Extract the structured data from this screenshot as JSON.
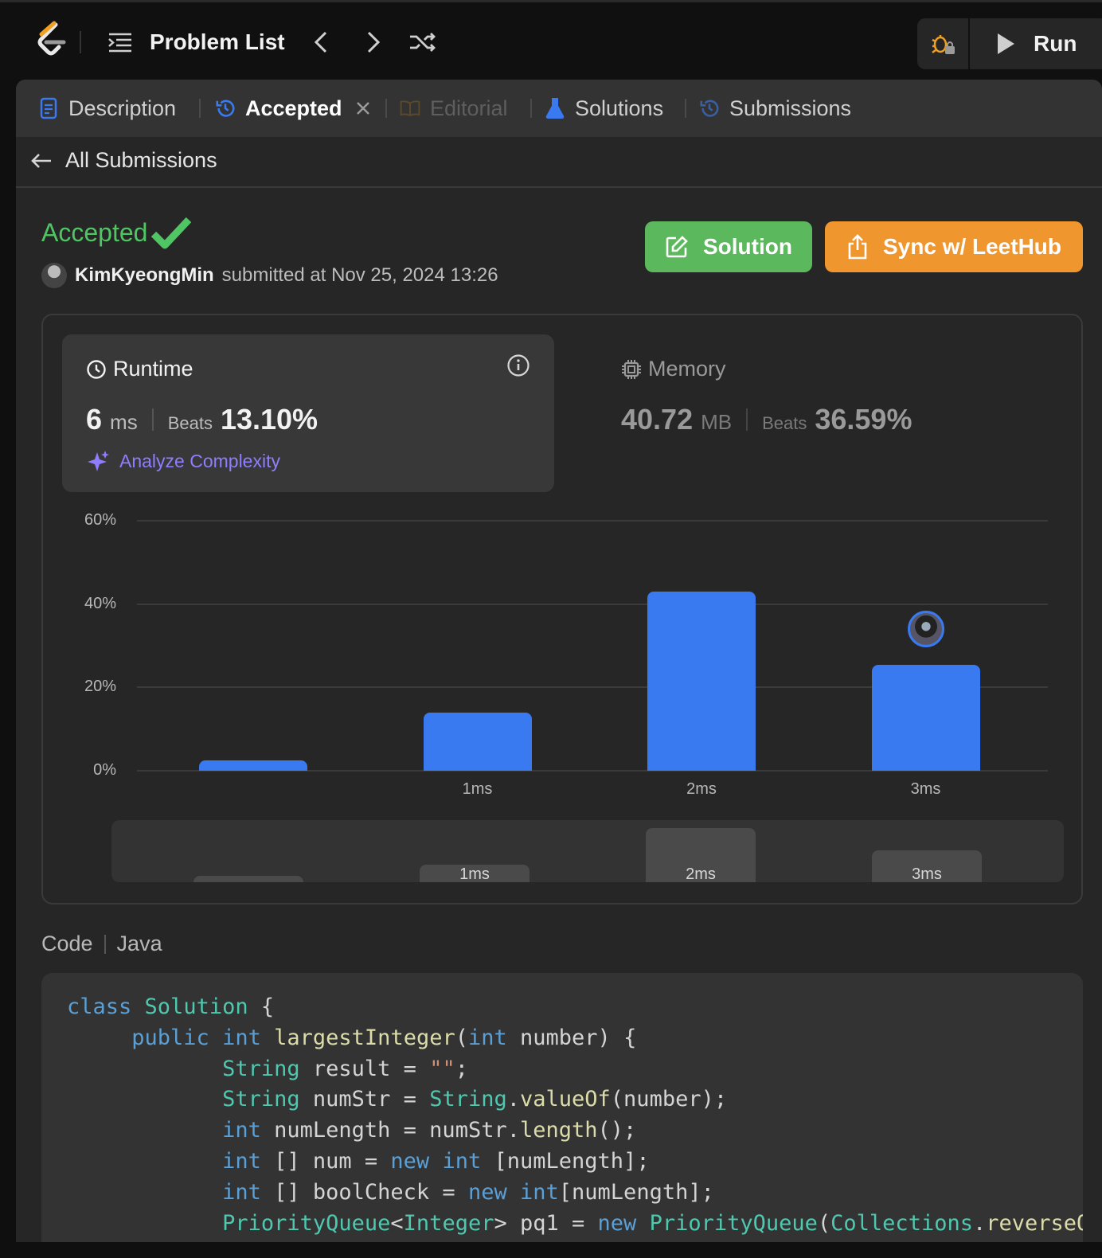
{
  "topbar": {
    "problem_list": "Problem List",
    "run_label": "Run",
    "icons": [
      "leetcode-logo",
      "list-icon",
      "chevron-left-icon",
      "chevron-right-icon",
      "shuffle-icon",
      "debug-icon",
      "play-icon"
    ]
  },
  "tabs": [
    {
      "label": "Description",
      "icon": "description-icon"
    },
    {
      "label": "Accepted",
      "icon": "history-icon",
      "active": true
    },
    {
      "label": "Editorial",
      "icon": "book-icon",
      "disabled": true
    },
    {
      "label": "Solutions",
      "icon": "flask-icon"
    },
    {
      "label": "Submissions",
      "icon": "history-icon"
    }
  ],
  "back_label": "All Submissions",
  "result": {
    "status": "Accepted",
    "user": "KimKyeongMin",
    "submitted": "submitted at Nov 25, 2024 13:26"
  },
  "buttons": {
    "solution": "Solution",
    "sync": "Sync w/ LeetHub"
  },
  "runtime": {
    "title": "Runtime",
    "value": "6",
    "unit": "ms",
    "beats_label": "Beats",
    "beats": "13.10%",
    "analyze": "Analyze Complexity"
  },
  "memory": {
    "title": "Memory",
    "value": "40.72",
    "unit": "MB",
    "beats_label": "Beats",
    "beats": "36.59%"
  },
  "chart_data": {
    "type": "bar",
    "categories": [
      "",
      "1ms",
      "2ms",
      "3ms"
    ],
    "values": [
      2.5,
      14,
      43,
      25.5
    ],
    "ylim": [
      0,
      60
    ],
    "yticks": [
      "0%",
      "20%",
      "40%",
      "60%"
    ],
    "grid": true,
    "marker_category": "3ms",
    "bar_color": "#3a7af0",
    "overview_labels": [
      "",
      "1ms",
      "2ms",
      "3ms"
    ],
    "overview_values": [
      2.5,
      14,
      43,
      25.5
    ]
  },
  "code": {
    "label": "Code",
    "language": "Java"
  },
  "colors": {
    "accent_green": "#4fc563",
    "solution_btn": "#5cb85c",
    "sync_btn": "#f0962e",
    "analyze": "#8f7dff"
  }
}
